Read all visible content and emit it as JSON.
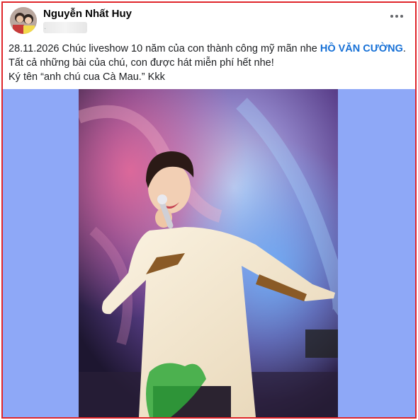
{
  "post": {
    "author": "Nguyễn Nhất Huy",
    "meta": "·",
    "text_before": "28.11.2026 Chúc liveshow 10 năm của con thành công mỹ mãn nhe ",
    "mention": "HỒ VĂN CƯỜNG",
    "text_after": ". Tất cả những bài của chú, con được hát miễn phí hết nhe!",
    "line2": "Ký tên “anh chú cua Cà Mau.” Kkk"
  },
  "icons": {
    "more": "more-options-icon",
    "avatar": "profile-avatar"
  },
  "colors": {
    "border": "#e0262a",
    "mention": "#1670d6",
    "media_bg": "#8ea8f7"
  }
}
